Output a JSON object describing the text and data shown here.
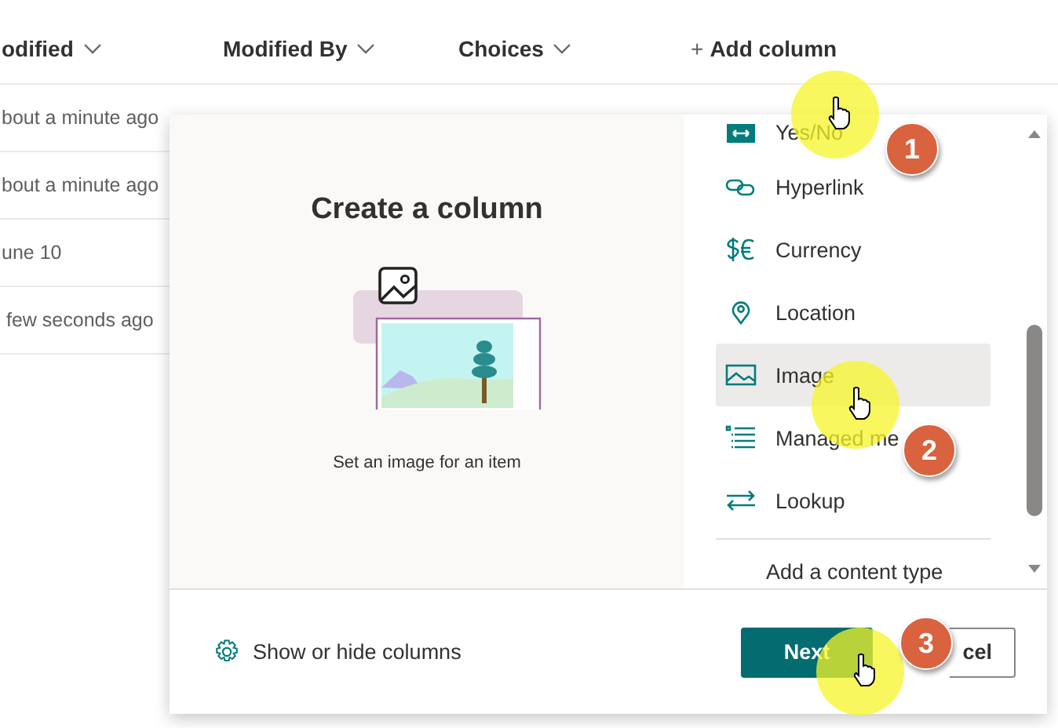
{
  "columns": [
    {
      "label": "odified"
    },
    {
      "label": "Modified By"
    },
    {
      "label": "Choices"
    }
  ],
  "add_column": {
    "label": "Add column",
    "icon": "+"
  },
  "rows": [
    "bout a minute ago",
    "bout a minute ago",
    "une 10",
    "few seconds ago"
  ],
  "panel": {
    "title": "Create a column",
    "caption": "Set an image for an item",
    "types": [
      {
        "label": "Yes/No",
        "kind": "yesno",
        "selected": false
      },
      {
        "label": "Hyperlink",
        "kind": "link",
        "selected": false
      },
      {
        "label": "Currency",
        "kind": "currency",
        "selected": false
      },
      {
        "label": "Location",
        "kind": "location",
        "selected": false
      },
      {
        "label": "Image",
        "kind": "image",
        "selected": true
      },
      {
        "label": "Managed me",
        "kind": "managed",
        "selected": false
      },
      {
        "label": "Lookup",
        "kind": "lookup",
        "selected": false
      }
    ],
    "content_type": "Add a content type",
    "footer_link": "Show or hide columns",
    "buttons": [
      {
        "label": "Next",
        "kind": "primary"
      },
      {
        "label": "cel",
        "kind": "default"
      }
    ]
  },
  "steps": [
    {
      "number": "1"
    },
    {
      "number": "2"
    },
    {
      "number": "3"
    }
  ]
}
